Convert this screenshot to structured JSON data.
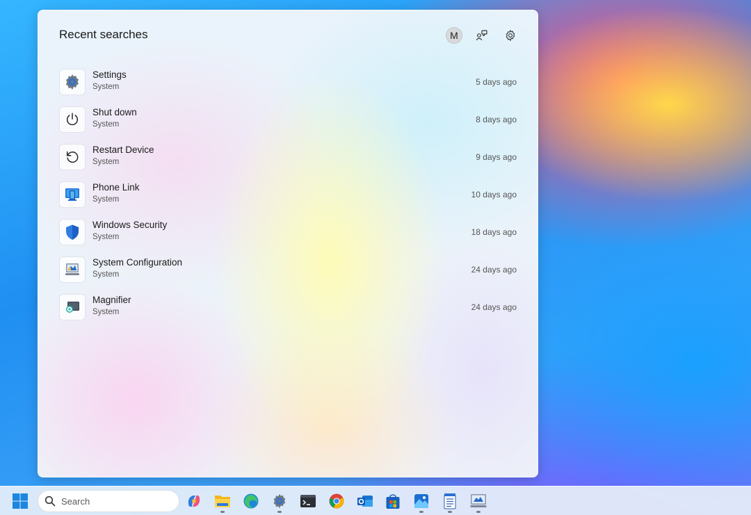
{
  "panel": {
    "title": "Recent searches",
    "avatar_initial": "M"
  },
  "recent_searches": [
    {
      "name": "Settings",
      "category": "System",
      "time": "5 days ago",
      "icon": "settings-gear-icon"
    },
    {
      "name": "Shut down",
      "category": "System",
      "time": "8 days ago",
      "icon": "power-icon"
    },
    {
      "name": "Restart Device",
      "category": "System",
      "time": "9 days ago",
      "icon": "restart-icon"
    },
    {
      "name": "Phone Link",
      "category": "System",
      "time": "10 days ago",
      "icon": "phone-link-icon"
    },
    {
      "name": "Windows Security",
      "category": "System",
      "time": "18 days ago",
      "icon": "shield-icon"
    },
    {
      "name": "System Configuration",
      "category": "System",
      "time": "24 days ago",
      "icon": "system-configuration-icon"
    },
    {
      "name": "Magnifier",
      "category": "System",
      "time": "24 days ago",
      "icon": "magnifier-icon"
    }
  ],
  "taskbar": {
    "search_placeholder": "Search",
    "apps": [
      "copilot",
      "file-explorer",
      "edge",
      "settings",
      "terminal",
      "chrome",
      "outlook",
      "store",
      "photos",
      "notepad",
      "remote-desktop"
    ]
  },
  "colors": {
    "accent": "#0078d4",
    "shield": "#2f7de1"
  }
}
